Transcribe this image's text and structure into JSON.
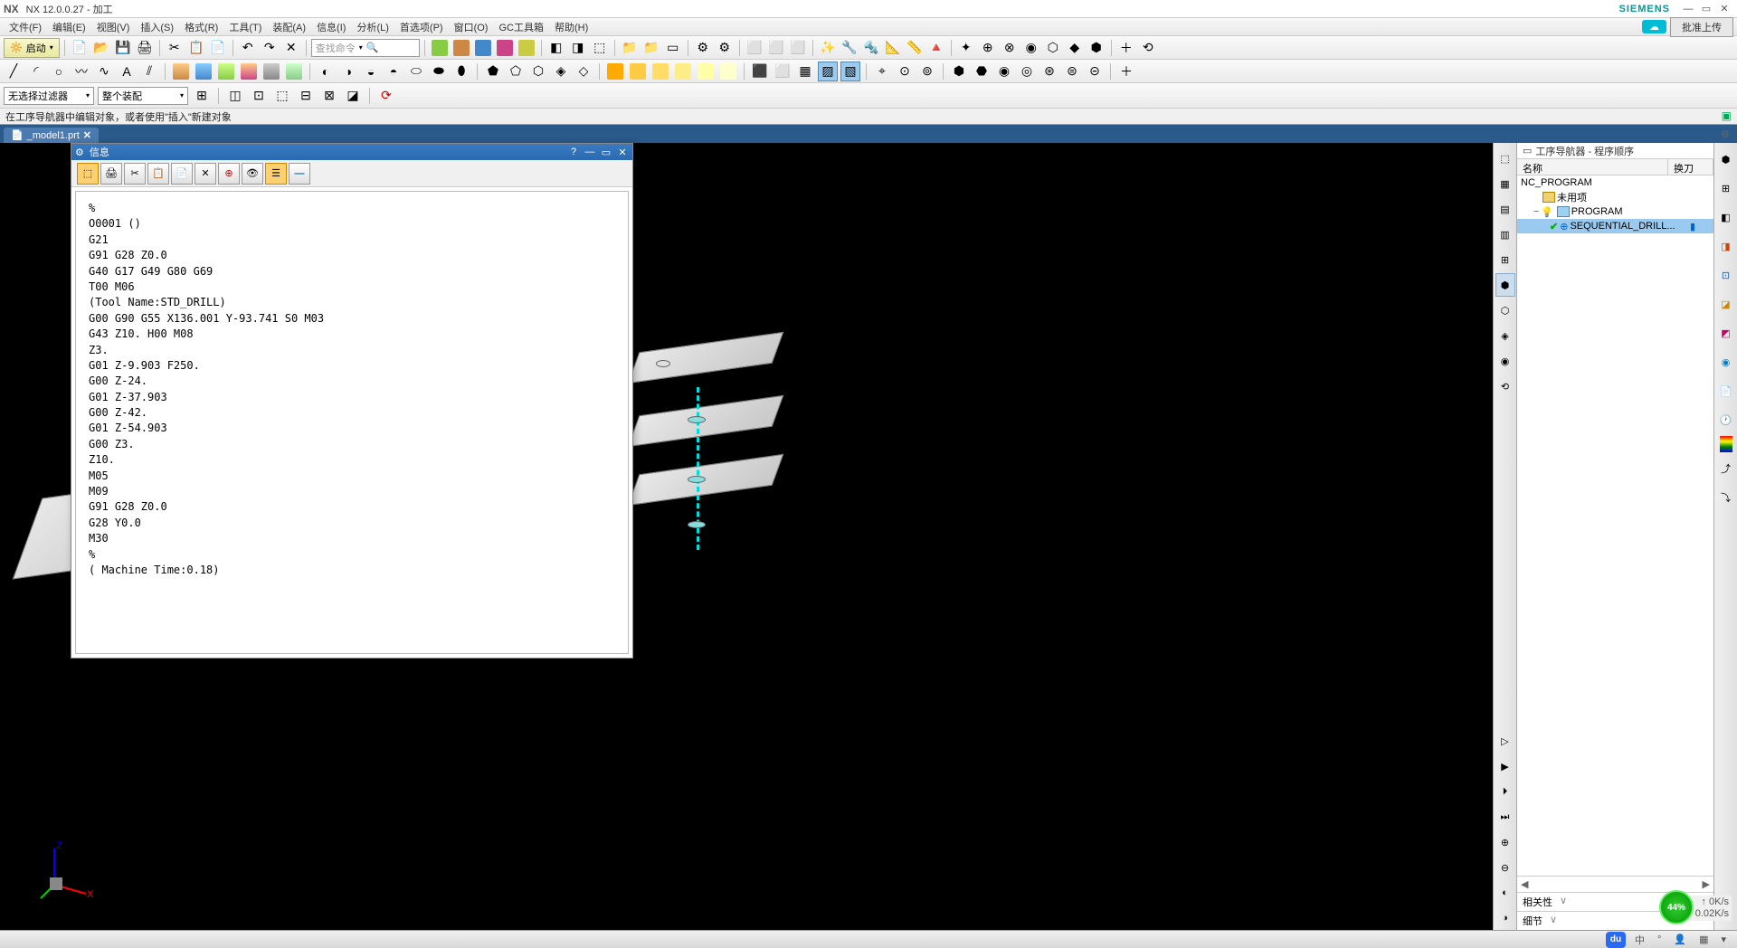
{
  "title": {
    "app": "NX",
    "version": "NX 12.0.0.27 - 加工",
    "brand": "SIEMENS"
  },
  "menu": [
    "文件(F)",
    "编辑(E)",
    "视图(V)",
    "插入(S)",
    "格式(R)",
    "工具(T)",
    "装配(A)",
    "信息(I)",
    "分析(L)",
    "首选项(P)",
    "窗口(O)",
    "GC工具箱",
    "帮助(H)"
  ],
  "menu_right": {
    "upload": "批准上传"
  },
  "toolbar1": {
    "launch": "启动",
    "search_placeholder": "查找命令"
  },
  "filters": {
    "f1": "无选择过滤器",
    "f2": "整个装配"
  },
  "status": "在工序导航器中编辑对象，或者使用\"插入\"新建对象",
  "tab": {
    "name": "_model1.prt",
    "dirty": "✕"
  },
  "info_window": {
    "title": "信息",
    "lines": [
      "%",
      "O0001 ()",
      "G21",
      "G91 G28 Z0.0",
      "G40 G17 G49 G80 G69",
      "T00 M06",
      "(Tool Name:STD_DRILL)",
      "G00 G90 G55 X136.001 Y-93.741 S0 M03",
      "G43 Z10. H00 M08",
      "Z3.",
      "G01 Z-9.903 F250.",
      "G00 Z-24.",
      "G01 Z-37.903",
      "G00 Z-42.",
      "G01 Z-54.903",
      "G00 Z3.",
      "Z10.",
      "M05",
      "M09",
      "G91 G28 Z0.0",
      "G28 Y0.0",
      "M30",
      "%",
      "( Machine Time:0.18)"
    ]
  },
  "navigator": {
    "title": "工序导航器 - 程序顺序",
    "col1": "名称",
    "col2": "换刀",
    "tree": {
      "root": "NC_PROGRAM",
      "unused": "未用项",
      "program": "PROGRAM",
      "op": "SEQUENTIAL_DRILL...",
      "op_col2": "▮"
    },
    "footer": {
      "rel": "相关性",
      "det": "细节"
    }
  },
  "bottom": {
    "speed": "44%",
    "up": "0K/s",
    "down": "0.02K/s",
    "zhong": "中",
    "detail_label": "细节"
  },
  "csys": {
    "x": "X",
    "y": "Y",
    "z": "Z"
  }
}
